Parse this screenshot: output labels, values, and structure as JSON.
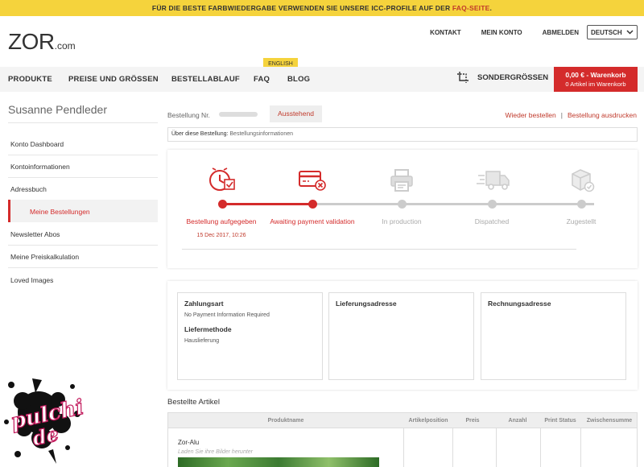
{
  "banner": {
    "text": "FÜR DIE BESTE FARBWIEDERGABE VERWENDEN SIE UNSERE ICC-PROFILE AUF DER ",
    "link": "FAQ-SEITE",
    "end": "."
  },
  "logo": {
    "main": "ZOR",
    "suffix": ".com"
  },
  "topnav": {
    "kontakt": "KONTAKT",
    "konto": "MEIN KONTO",
    "abmelden": "ABMELDEN",
    "language": "DEUTSCH"
  },
  "nav": {
    "produkte": "PRODUKTE",
    "preise": "PREISE UND GRÖSSEN",
    "ablauf": "BESTELLABLAUF",
    "faq": "FAQ",
    "blog": "BLOG",
    "english_badge": "ENGLISH",
    "sonder": "SONDERGRÖSSEN"
  },
  "cart": {
    "line1": "0,00 € - Warenkorb",
    "line2": "0 Artikel im Warenkorb"
  },
  "sidebar": {
    "username": "Susanne Pendleder",
    "items": [
      "Konto Dashboard",
      "Kontoinformationen",
      "Adressbuch",
      "Meine Bestellungen",
      "Newsletter Abos",
      "Meine Preiskalkulation",
      "Loved Images"
    ]
  },
  "order": {
    "number_label": "Bestellung Nr.",
    "status": "Ausstehend",
    "reorder": "Wieder bestellen",
    "separator": "|",
    "print": "Bestellung ausdrucken",
    "info_label": "Über diese Bestellung:",
    "info_value": "Bestellungsinformationen"
  },
  "tracking": {
    "steps": [
      {
        "label": "Bestellung aufgegeben",
        "date": "15 Dec 2017, 10:26",
        "state": "done"
      },
      {
        "label": "Awaiting payment validation",
        "date": "",
        "state": "current"
      },
      {
        "label": "In production",
        "date": "",
        "state": "pending"
      },
      {
        "label": "Dispatched",
        "date": "",
        "state": "pending"
      },
      {
        "label": "Zugestellt",
        "date": "",
        "state": "pending"
      }
    ]
  },
  "details": {
    "payment_heading": "Zahlungsart",
    "payment_value": "No Payment Information Required",
    "delivery_heading": "Liefermethode",
    "delivery_value": "Hauslieferung",
    "shipping_heading": "Lieferungsadresse",
    "billing_heading": "Rechnungsadresse"
  },
  "items": {
    "heading": "Bestellte Artikel",
    "columns": [
      "Produktname",
      "Artikelposition",
      "Preis",
      "Anzahl",
      "Print Status",
      "Zwischensumme"
    ],
    "rows": [
      {
        "name": "Zor-Alu",
        "loading": "Laden Sie ihre Bilder herunter"
      }
    ]
  },
  "watermark": {
    "text1": "pulchi",
    "text2": "de"
  },
  "colors": {
    "accent": "#d42b2b",
    "banner": "#f5d33c",
    "inactive": "#cccccc"
  }
}
